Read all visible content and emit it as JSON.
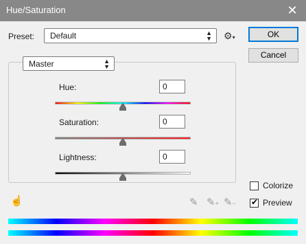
{
  "window": {
    "title": "Hue/Saturation",
    "close_glyph": "✕"
  },
  "preset": {
    "label": "Preset:",
    "value": "Default"
  },
  "buttons": {
    "ok": "OK",
    "cancel": "Cancel"
  },
  "channel": {
    "value": "Master"
  },
  "hue": {
    "label": "Hue:",
    "value": "0",
    "slider_fraction": 0.5
  },
  "saturation": {
    "label": "Saturation:",
    "value": "0",
    "slider_fraction": 0.5
  },
  "lightness": {
    "label": "Lightness:",
    "value": "0",
    "slider_fraction": 0.5
  },
  "options": {
    "colorize": {
      "label": "Colorize",
      "checked": false
    },
    "preview": {
      "label": "Preview",
      "checked": true
    }
  },
  "icons": {
    "settings": "gear-icon",
    "hand_tool": "targeted-adjustment-hand-icon",
    "eyedropper": "eyedropper-icon",
    "eyedropper_plus": "eyedropper-plus-icon",
    "eyedropper_minus": "eyedropper-minus-icon"
  },
  "colors": {
    "title_bar": "#888888",
    "ok_border": "#0078d7"
  }
}
